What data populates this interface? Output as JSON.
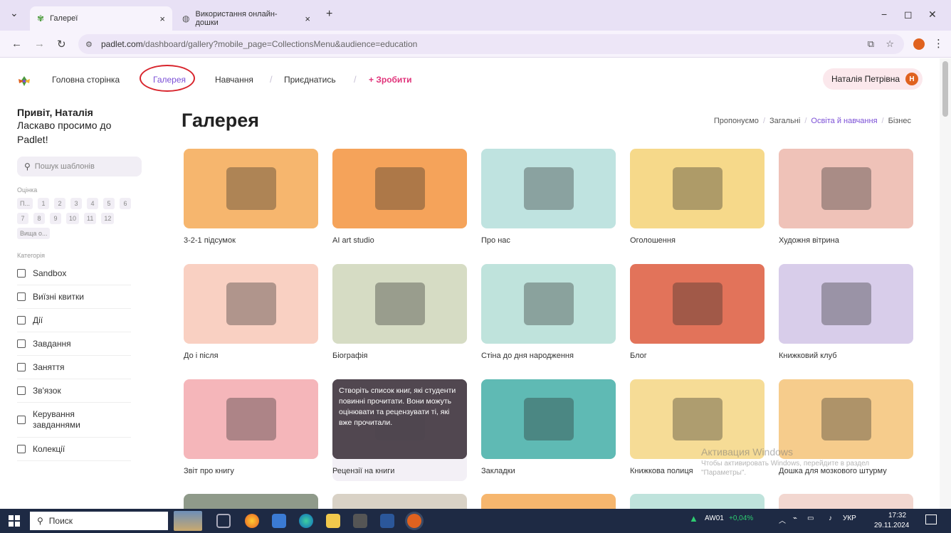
{
  "browser": {
    "tabs": [
      {
        "label": "Галереї",
        "close": "×"
      },
      {
        "label": "Використання онлайн-дошки",
        "close": "×"
      }
    ],
    "new_tab": "+",
    "tab_menu": "⌄",
    "window_controls": [
      "−",
      "◻",
      "✕"
    ],
    "url_host": "padlet.com",
    "url_path": "/dashboard/gallery?mobile_page=CollectionsMenu&audience=education"
  },
  "nav": {
    "items": [
      "Головна сторінка",
      "Галерея",
      "Навчання",
      "Приєднатись",
      "+ Зробити"
    ],
    "separators": [
      "/",
      "/"
    ],
    "user_name": "Наталія Петрівна",
    "avatar_initial": "Н"
  },
  "sidebar": {
    "greeting": "Привіт, Наталія",
    "welcome": "Ласкаво просимо до Padlet!",
    "search_placeholder": "Пошук шаблонів",
    "grades_label": "Оцінка",
    "grades": [
      "П...",
      "1",
      "2",
      "3",
      "4",
      "5",
      "6",
      "7",
      "8",
      "9",
      "10",
      "11",
      "12",
      "Вища о..."
    ],
    "category_label": "Категорія",
    "categories": [
      "Sandbox",
      "Виїзні квитки",
      "Дії",
      "Завдання",
      "Заняття",
      "Зв'язок",
      "Керування завданнями",
      "Колекції"
    ]
  },
  "main": {
    "title": "Галерея",
    "filters": [
      "Пропонуємо",
      "Загальні",
      "Освіта й навчання",
      "Бізнес"
    ],
    "filter_sep": "/",
    "cards": [
      {
        "label": "3-2-1 підсумок",
        "color": "#f6b66e"
      },
      {
        "label": "AI art studio",
        "color": "#f5a35a"
      },
      {
        "label": "Про нас",
        "color": "#bfe3e0"
      },
      {
        "label": "Оголошення",
        "color": "#f6d98a"
      },
      {
        "label": "Художня вітрина",
        "color": "#efc2b8"
      },
      {
        "label": "До і після",
        "color": "#f9d0c2"
      },
      {
        "label": "Біографія",
        "color": "#d6dcc4"
      },
      {
        "label": "Стіна до дня народження",
        "color": "#bfe3dc"
      },
      {
        "label": "Блог",
        "color": "#e2735a"
      },
      {
        "label": "Книжковий клуб",
        "color": "#d8cdea"
      },
      {
        "label": "Звіт про книгу",
        "color": "#f5b6ba"
      },
      {
        "label": "Рецензії на книги",
        "color": "#5a4c55",
        "overlay": "Створіть список книг, які студенти повинні прочитати. Вони можуть оцінювати та рецензувати ті, які вже прочитали."
      },
      {
        "label": "Закладки",
        "color": "#5fbab4"
      },
      {
        "label": "Книжкова полиця",
        "color": "#f6dc96"
      },
      {
        "label": "Дошка для мозкового штурму",
        "color": "#f6cc8c"
      }
    ]
  },
  "watermark": {
    "title": "Активация Windows",
    "sub": "Чтобы активировать Windows, перейдите в раздел \"Параметры\"."
  },
  "taskbar": {
    "search": "Поиск",
    "stock_name": "AW01",
    "stock_change": "+0,04%",
    "lang": "УКР",
    "time": "17:32",
    "date": "29.11.2024"
  }
}
